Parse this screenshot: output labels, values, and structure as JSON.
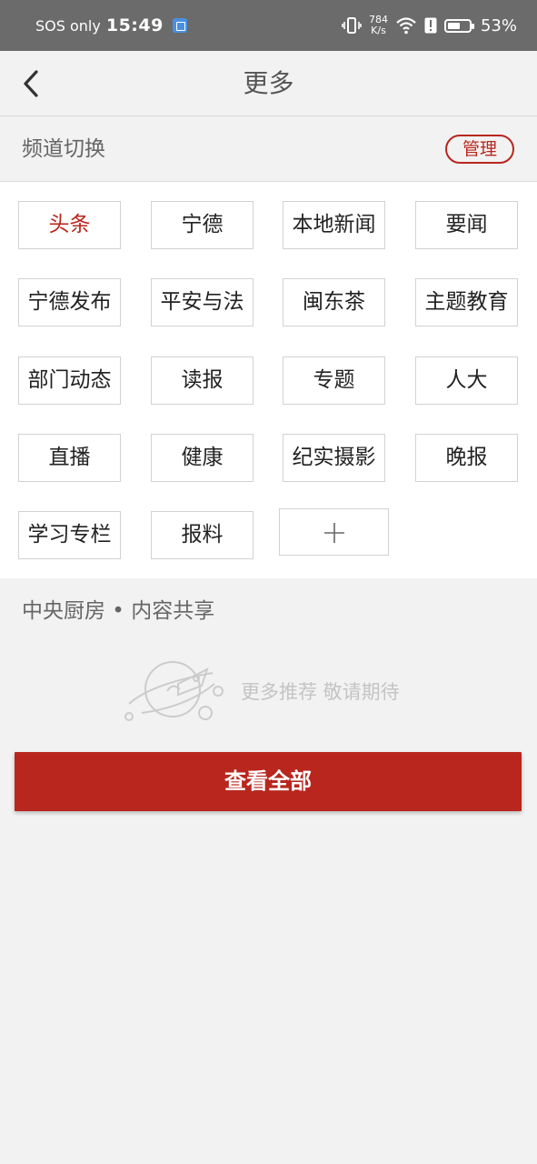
{
  "status_bar": {
    "sos": "SOS only",
    "time": "15:49",
    "speed_top": "784",
    "speed_bottom": "K/s",
    "battery": "53%",
    "battery_level": 0.53
  },
  "header": {
    "title": "更多"
  },
  "channel_section": {
    "title": "频道切换",
    "manage_label": "管理"
  },
  "channels": [
    {
      "label": "头条",
      "active": true
    },
    {
      "label": "宁德",
      "active": false
    },
    {
      "label": "本地新闻",
      "active": false
    },
    {
      "label": "要闻",
      "active": false
    },
    {
      "label": "宁德发布",
      "active": false
    },
    {
      "label": "平安与法",
      "active": false
    },
    {
      "label": "闽东茶",
      "active": false
    },
    {
      "label": "主题教育",
      "active": false
    },
    {
      "label": "部门动态",
      "active": false
    },
    {
      "label": "读报",
      "active": false
    },
    {
      "label": "专题",
      "active": false
    },
    {
      "label": "人大",
      "active": false
    },
    {
      "label": "直播",
      "active": false
    },
    {
      "label": "健康",
      "active": false
    },
    {
      "label": "纪实摄影",
      "active": false
    },
    {
      "label": "晚报",
      "active": false
    },
    {
      "label": "学习专栏",
      "active": false
    },
    {
      "label": "报料",
      "active": false
    }
  ],
  "kitchen_section": {
    "title": "中央厨房 • 内容共享",
    "empty_text": "更多推荐 敬请期待",
    "view_all_label": "查看全部"
  },
  "colors": {
    "accent": "#b8261e",
    "status_bar": "#6b6b6b",
    "background": "#f2f2f2"
  },
  "icons": [
    "back-arrow-icon",
    "plus-icon",
    "rocket-planet-icon",
    "vibrate-icon",
    "wifi-icon",
    "alert-icon",
    "battery-icon"
  ]
}
